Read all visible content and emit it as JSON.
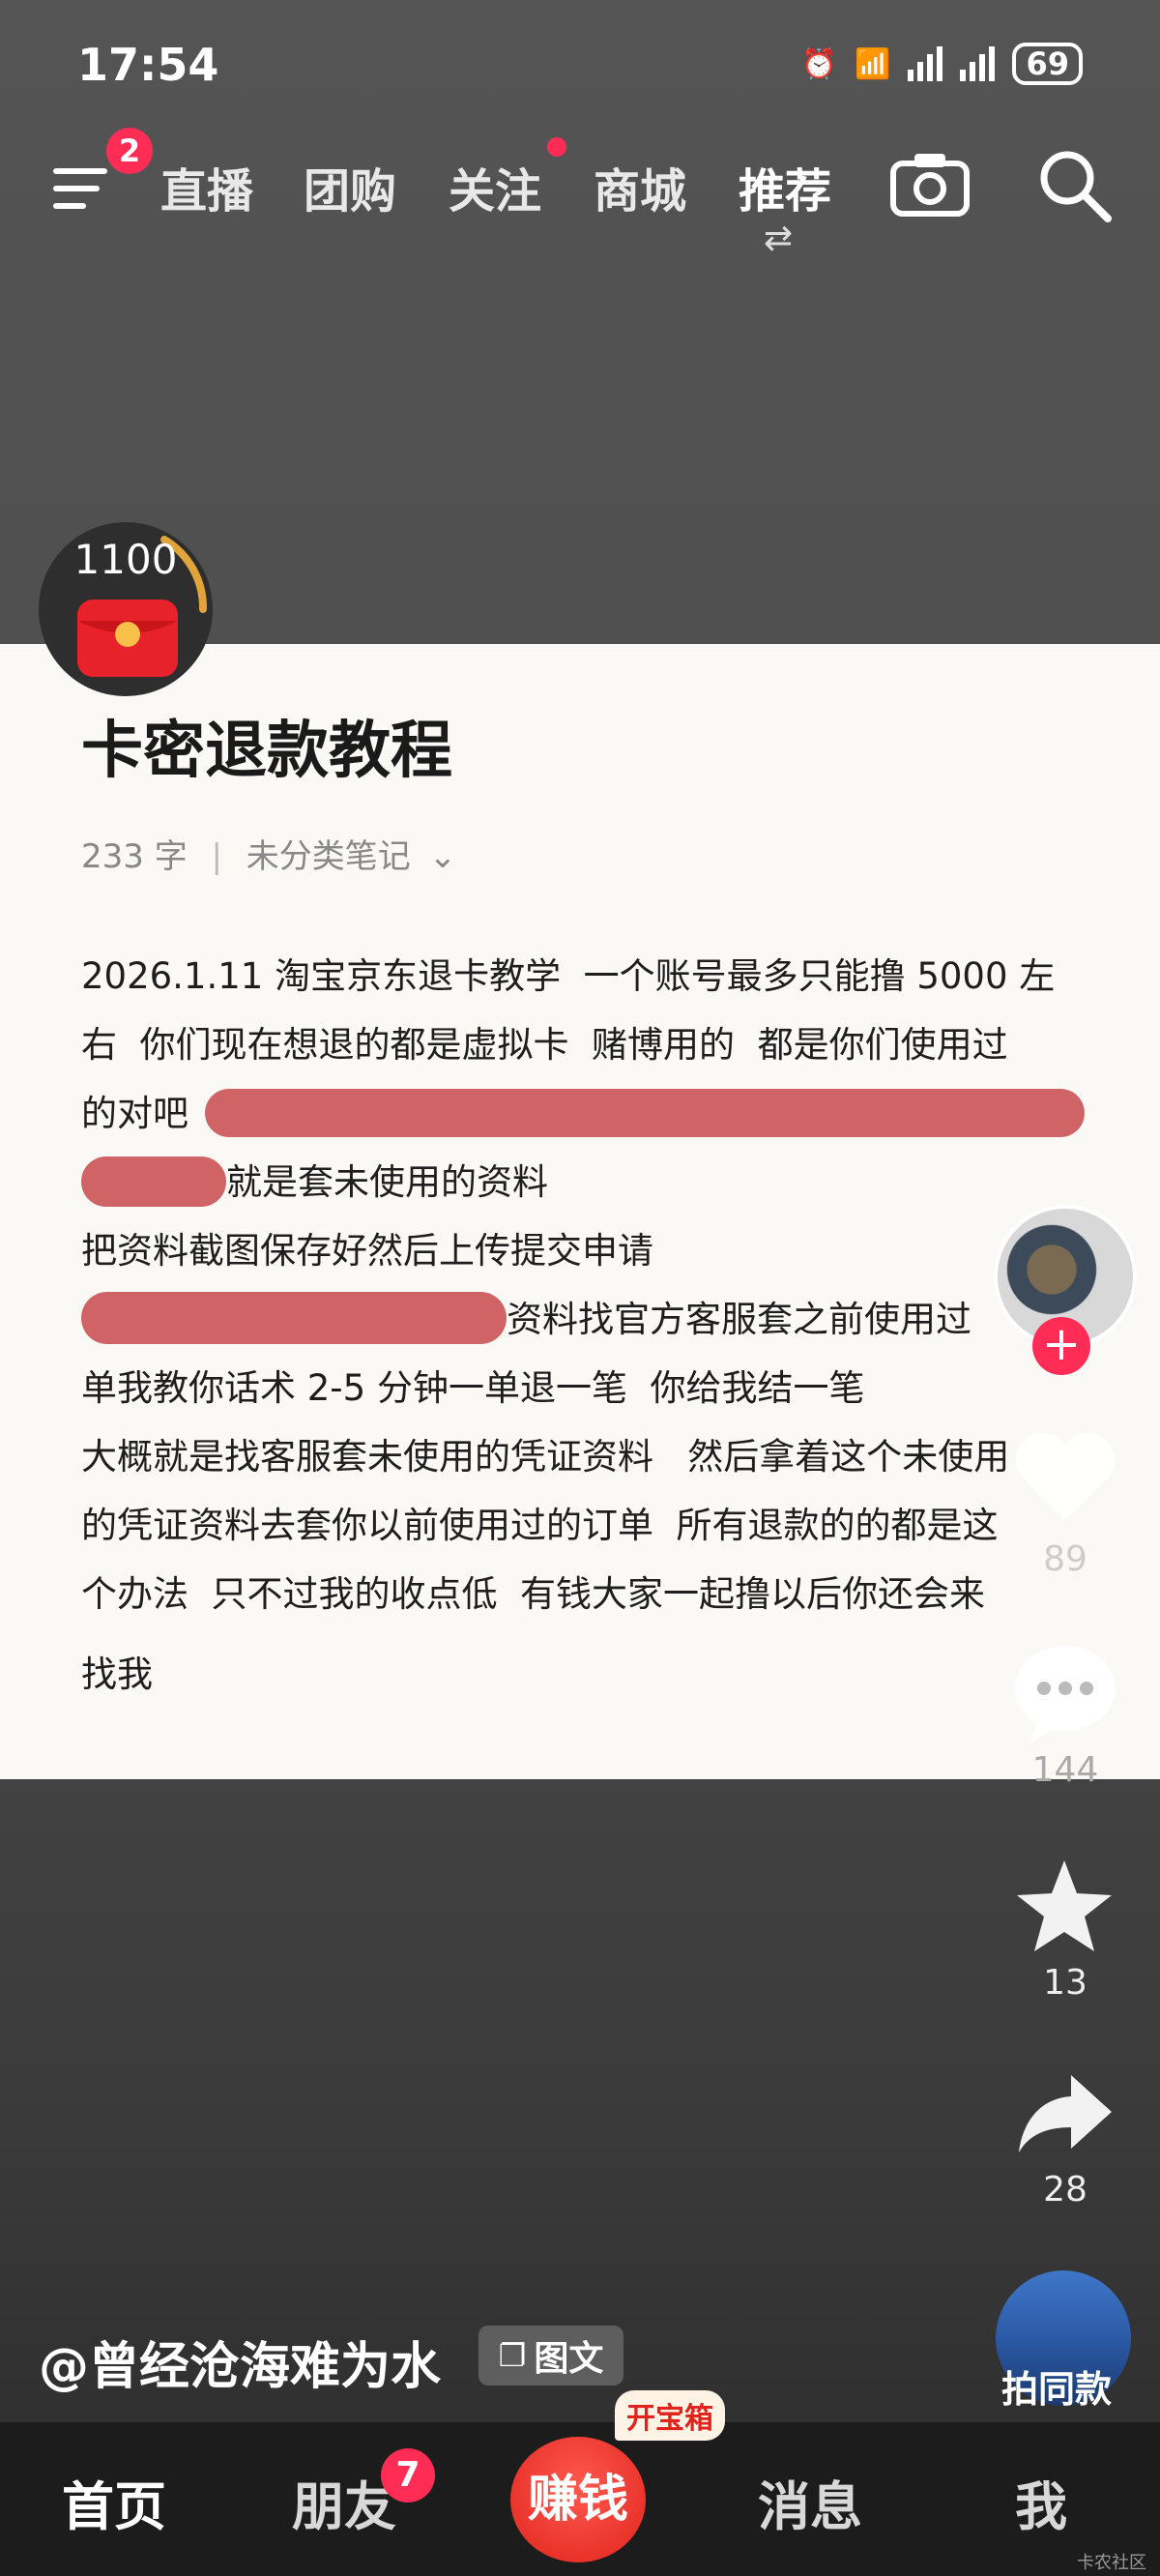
{
  "status_bar": {
    "time": "17:54",
    "battery": "69"
  },
  "top_nav": {
    "menu_badge": "2",
    "tabs": [
      {
        "label": "直播"
      },
      {
        "label": "团购"
      },
      {
        "label": "关注"
      },
      {
        "label": "商城"
      },
      {
        "label": "推荐"
      }
    ]
  },
  "coin_widget": {
    "value": "1100"
  },
  "note": {
    "title": "卡密退款教程",
    "word_count": "233 字",
    "category": "未分类笔记",
    "lines": [
      "2026.1.11 淘宝京东退卡教学  一个账号最多只能撸 5000 左",
      "右  你们现在想退的都是虚拟卡  赌博用的  都是你们使用过",
      "的对吧",
      "就是套未使用的资料",
      "把资料截图保存好然后上传提交申请",
      "资料找官方客服套之前使用过",
      "单我教你话术 2-5 分钟一单退一笔  你给我结一笔",
      "大概就是找客服套未使用的凭证资料   然后拿着这个未使用",
      "的凭证资料去套你以前使用过的订单  所有退款的的都是这",
      "个办法  只不过我的收点低  有钱大家一起撸以后你还会来",
      "找我"
    ]
  },
  "right_rail": {
    "likes": "89",
    "comments": "144",
    "favorites": "13",
    "shares": "28"
  },
  "author": {
    "handle": "@曾经沧海难为水",
    "type_tag": "图文"
  },
  "same_style_label": "拍同款",
  "bottom_bar": {
    "home": "首页",
    "friends": "朋友",
    "friends_badge": "7",
    "earn": "赚钱",
    "treasure": "开宝箱",
    "messages": "消息",
    "me": "我"
  },
  "watermark": "卡农社区"
}
